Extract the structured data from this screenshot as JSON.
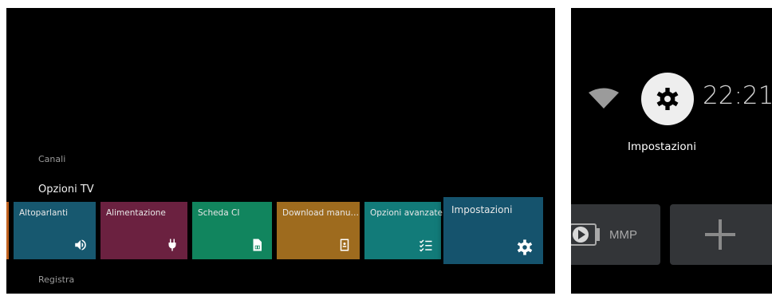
{
  "left_panel": {
    "section_canali": "Canali",
    "row_title": "Opzioni TV",
    "section_registra": "Registra",
    "tiles": [
      {
        "label": "Altoparlanti",
        "icon": "speaker-icon",
        "color": "#17586f"
      },
      {
        "label": "Alimentazione",
        "icon": "plug-icon",
        "color": "#6b2140"
      },
      {
        "label": "Scheda CI",
        "icon": "sim-card-icon",
        "color": "#11855e"
      },
      {
        "label": "Download manua…",
        "icon": "manual-book-icon",
        "color": "#9e6b1e"
      },
      {
        "label": "Opzioni avanzate",
        "icon": "checklist-icon",
        "color": "#127b79"
      },
      {
        "label": "Impostazioni",
        "icon": "gear-icon",
        "color": "#15536d",
        "focused": true
      }
    ],
    "edge_tile_color": "#c0611e"
  },
  "right_panel": {
    "clock": "22:21",
    "focused_label": "Impostazioni",
    "apps": [
      {
        "label": "MMP",
        "icon": "mmp-play-icon"
      },
      {
        "label": "",
        "icon": "plus-icon"
      }
    ]
  }
}
